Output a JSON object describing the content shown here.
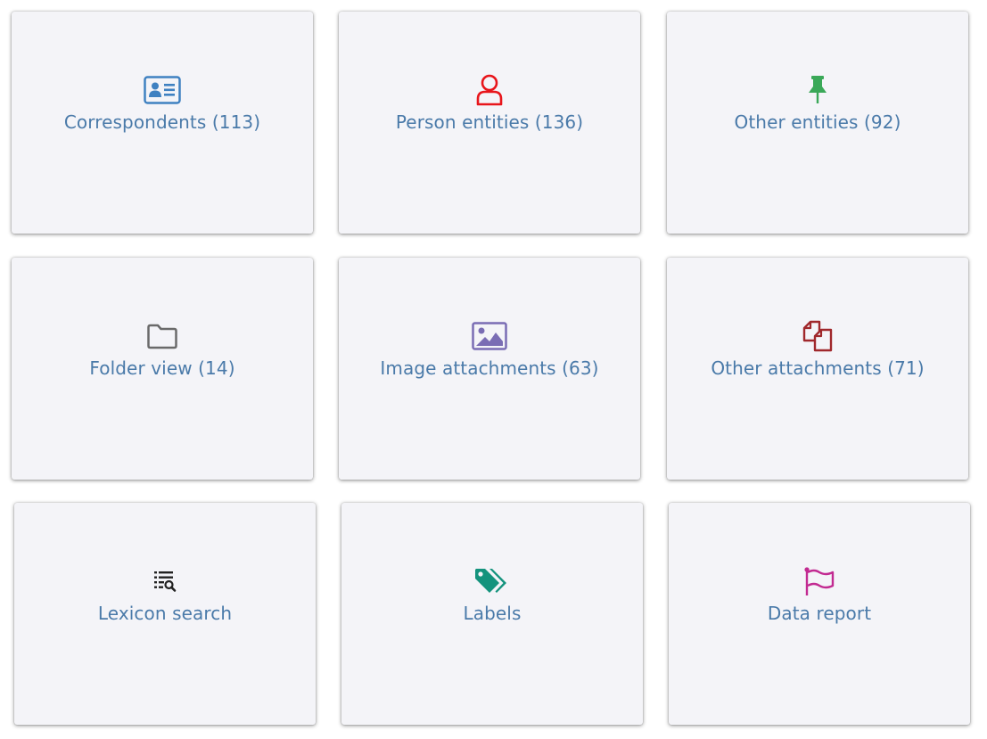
{
  "colors": {
    "card_background": "#f4f4f8",
    "label_text": "#4a7aa9"
  },
  "tiles": [
    {
      "label": "Correspondents (113)",
      "icon": "id-card-icon",
      "icon_color": "#3f81c1"
    },
    {
      "label": "Person entities (136)",
      "icon": "user-icon",
      "icon_color": "#e8151b"
    },
    {
      "label": "Other entities (92)",
      "icon": "pushpin-icon",
      "icon_color": "#3aa858"
    },
    {
      "label": "Folder view (14)",
      "icon": "folder-icon",
      "icon_color": "#6a6a6a"
    },
    {
      "label": "Image attachments (63)",
      "icon": "image-icon",
      "icon_color": "#7a6db4"
    },
    {
      "label": "Other attachments (71)",
      "icon": "copy-files-icon",
      "icon_color": "#a0282c"
    },
    {
      "label": "Lexicon search",
      "icon": "list-search-icon",
      "icon_color": "#222222"
    },
    {
      "label": "Labels",
      "icon": "tags-icon",
      "icon_color": "#14937d"
    },
    {
      "label": "Data report",
      "icon": "flag-icon",
      "icon_color": "#c22a91"
    }
  ]
}
